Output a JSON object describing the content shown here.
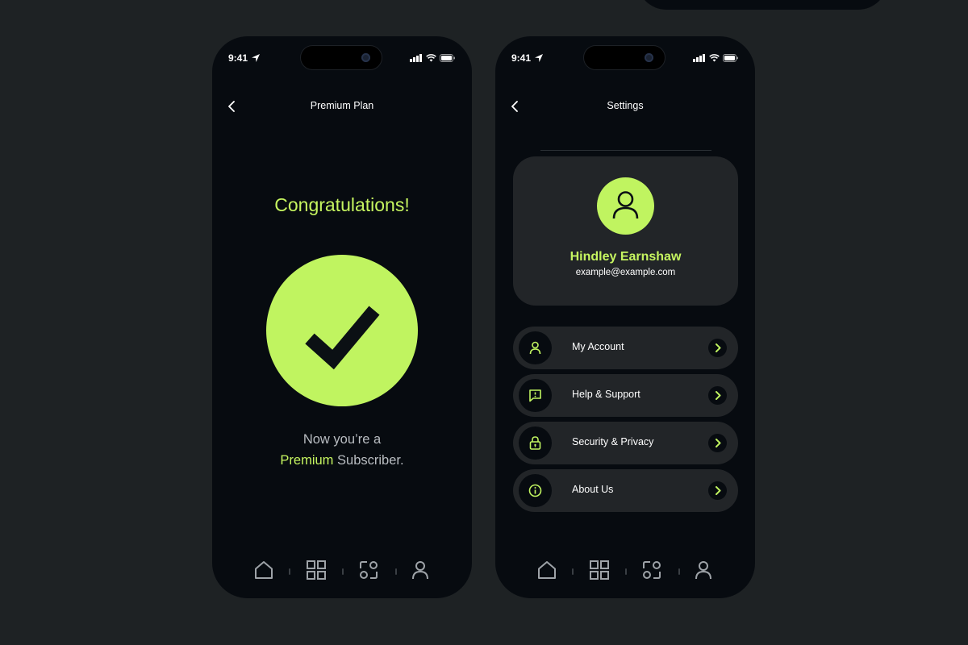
{
  "colors": {
    "background": "#1e2224",
    "phone": "#070b10",
    "accent": "#c0f460",
    "card": "#222528"
  },
  "status_bar": {
    "time": "9:41"
  },
  "screen_premium": {
    "title": "Premium Plan",
    "heading": "Congratulations!",
    "message_line1": "Now you’re a",
    "message_accent": "Premium",
    "message_rest": " Subscriber.",
    "icon": "check-icon"
  },
  "screen_settings": {
    "title": "Settings",
    "profile": {
      "name": "Hindley Earnshaw",
      "email": "example@example.com",
      "icon": "user-icon"
    },
    "menu": [
      {
        "label": "My Account",
        "icon": "user-icon"
      },
      {
        "label": "Help & Support",
        "icon": "message-alert-icon"
      },
      {
        "label": "Security & Privacy",
        "icon": "lock-icon"
      },
      {
        "label": "About Us",
        "icon": "info-icon"
      }
    ]
  },
  "tab_bar": [
    {
      "name": "home",
      "icon": "home-icon"
    },
    {
      "name": "grid",
      "icon": "grid-icon"
    },
    {
      "name": "scan",
      "icon": "scan-icon"
    },
    {
      "name": "profile",
      "icon": "profile-icon"
    }
  ]
}
